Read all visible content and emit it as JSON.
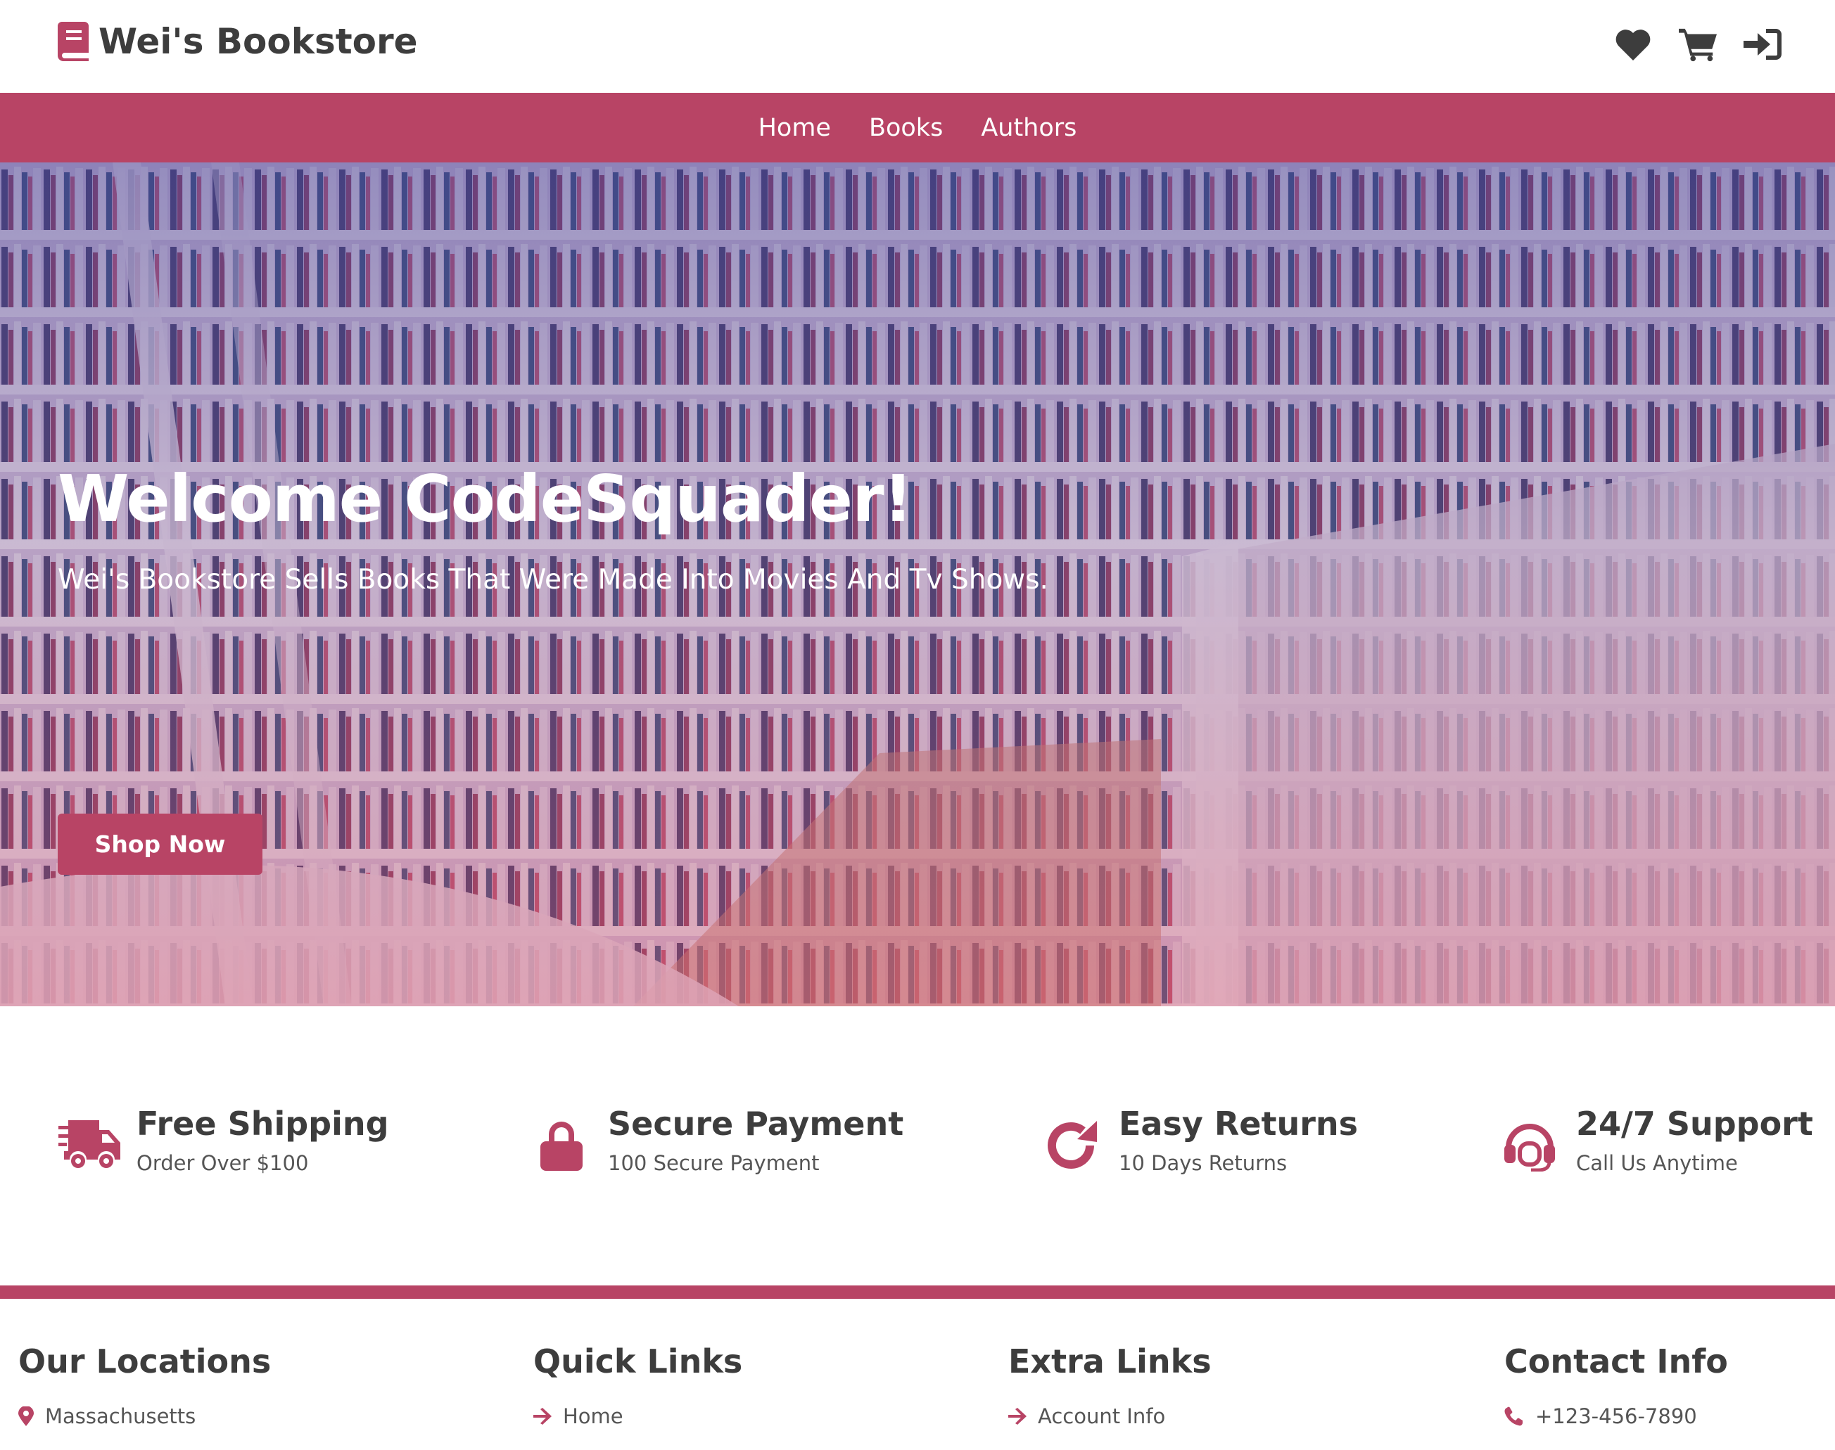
{
  "brand": {
    "name": "Wei's Bookstore",
    "accent_color": "#b84465",
    "logo_icon": "book-icon"
  },
  "header": {
    "icons": [
      "heart-icon",
      "cart-icon",
      "login-icon"
    ]
  },
  "nav": {
    "items": [
      {
        "label": "Home"
      },
      {
        "label": "Books"
      },
      {
        "label": "Authors"
      }
    ]
  },
  "hero": {
    "title": "Welcome CodeSquader!",
    "subtitle": "Wei's Bookstore Sells Books That Were Made Into Movies And Tv Shows.",
    "cta_label": "Shop Now"
  },
  "features": [
    {
      "icon": "truck-icon",
      "title": "Free Shipping",
      "subtitle": "Order Over $100"
    },
    {
      "icon": "lock-icon",
      "title": "Secure Payment",
      "subtitle": "100 Secure Payment"
    },
    {
      "icon": "redo-icon",
      "title": "Easy Returns",
      "subtitle": "10 Days Returns"
    },
    {
      "icon": "headset-icon",
      "title": "24/7 Support",
      "subtitle": "Call Us Anytime"
    }
  ],
  "footer": {
    "columns": [
      {
        "title": "Our Locations",
        "links": [
          {
            "icon": "map-pin-icon",
            "label": "Massachusetts"
          }
        ]
      },
      {
        "title": "Quick Links",
        "links": [
          {
            "icon": "arrow-right-icon",
            "label": "Home"
          }
        ]
      },
      {
        "title": "Extra Links",
        "links": [
          {
            "icon": "arrow-right-icon",
            "label": "Account Info"
          }
        ]
      },
      {
        "title": "Contact Info",
        "links": [
          {
            "icon": "phone-icon",
            "label": "+123-456-7890"
          }
        ]
      }
    ]
  }
}
